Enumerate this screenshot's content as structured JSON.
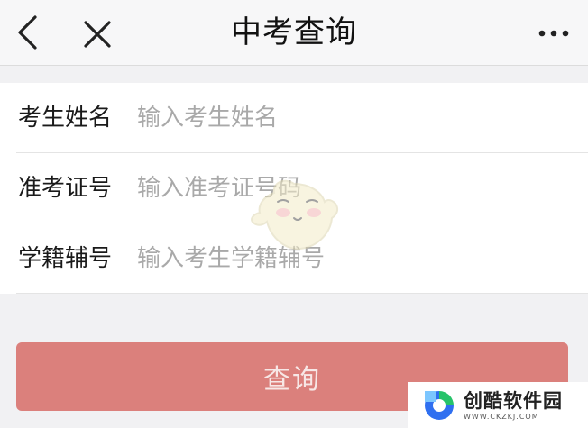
{
  "header": {
    "title": "中考查询",
    "back_icon": "chevron-left-icon",
    "close_icon": "close-icon",
    "more_icon": "more-horizontal-icon"
  },
  "form": {
    "fields": [
      {
        "label": "考生姓名",
        "placeholder": "输入考生姓名",
        "value": ""
      },
      {
        "label": "准考证号",
        "placeholder": "输入准考证号码",
        "value": ""
      },
      {
        "label": "学籍辅号",
        "placeholder": "输入考生学籍辅号",
        "value": ""
      }
    ]
  },
  "actions": {
    "query_label": "查询"
  },
  "watermark": {
    "brand": "创酷软件园",
    "url": "WWW.CKZKJ.COM"
  },
  "colors": {
    "button_bg": "#db807c",
    "page_bg": "#f1f1f3",
    "logo_blue": "#2f6ff0",
    "logo_green": "#27c36a"
  }
}
